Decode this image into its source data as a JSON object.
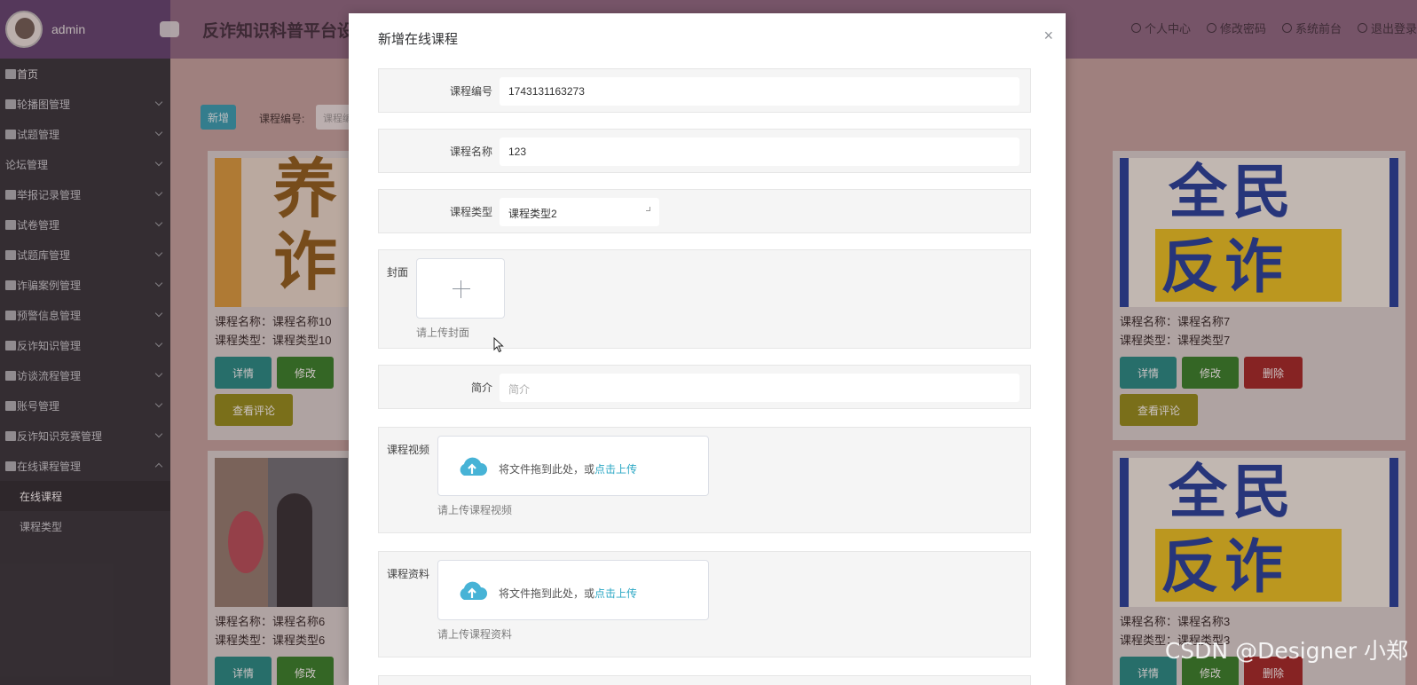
{
  "sidebar": {
    "admin_name": "admin",
    "menu": [
      {
        "label": "首页",
        "icon": "home-icon",
        "home": true
      },
      {
        "label": "轮播图管理",
        "icon": "image-icon"
      },
      {
        "label": "试题管理",
        "icon": "doc-icon"
      },
      {
        "label": "论坛管理",
        "icon": "none"
      },
      {
        "label": "举报记录管理",
        "icon": "doc-icon"
      },
      {
        "label": "试卷管理",
        "icon": "cloud-icon"
      },
      {
        "label": "试题库管理",
        "icon": "doc-icon"
      },
      {
        "label": "诈骗案例管理",
        "icon": "cloud-icon"
      },
      {
        "label": "预警信息管理",
        "icon": "circle-icon"
      },
      {
        "label": "反诈知识管理",
        "icon": "doc-icon"
      },
      {
        "label": "访谈流程管理",
        "icon": "doc-icon"
      },
      {
        "label": "账号管理",
        "icon": "user-icon"
      },
      {
        "label": "反诈知识竞赛管理",
        "icon": "circle-icon"
      },
      {
        "label": "在线课程管理",
        "icon": "cloud-icon",
        "expanded": true
      }
    ],
    "submenu": [
      {
        "label": "在线课程",
        "active": true
      },
      {
        "label": "课程类型"
      }
    ]
  },
  "topbar": {
    "title": "反诈知识科普平台设",
    "links": [
      "个人中心",
      "修改密码",
      "系统前台",
      "退出登录"
    ]
  },
  "toolbar": {
    "new_label": "新增",
    "search_label": "课程编号:",
    "search_placeholder": "课程编"
  },
  "cards": [
    {
      "name": "课程名称：课程名称10",
      "type": "课程类型：课程类型10"
    },
    {
      "name": "课程名称：课程名称7",
      "type": "课程类型：课程类型7"
    },
    {
      "name": "课程名称：课程名称6",
      "type": "课程类型：课程类型6"
    },
    {
      "name": "课程名称：课程名称3",
      "type": "课程类型：课程类型3"
    }
  ],
  "card_buttons": {
    "detail": "详情",
    "edit": "修改",
    "delete": "删除",
    "comments": "查看评论"
  },
  "poster_text": {
    "left_a": "养",
    "left_b": "诈",
    "right_a": "全民",
    "right_b": "反诈"
  },
  "dialog": {
    "title": "新增在线课程",
    "close": "×",
    "fields": {
      "code_label": "课程编号",
      "code_value": "1743131163273",
      "name_label": "课程名称",
      "name_value": "123",
      "type_label": "课程类型",
      "type_value": "课程类型2",
      "cover_label": "封面",
      "cover_tip": "请上传封面",
      "intro_label": "简介",
      "intro_placeholder": "简介",
      "video_label": "课程视频",
      "video_tip": "请上传课程视频",
      "material_label": "课程资料",
      "material_tip": "请上传课程资料",
      "drag_text": "将文件拖到此处，或",
      "drag_link": "点击上传"
    }
  },
  "watermark": "CSDN @Designer 小郑"
}
